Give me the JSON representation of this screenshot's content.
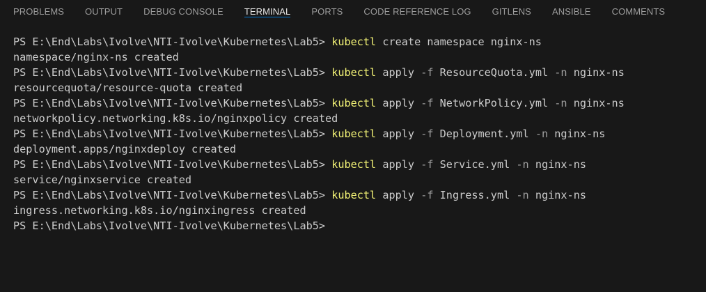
{
  "tabs": [
    {
      "label": "PROBLEMS",
      "active": false
    },
    {
      "label": "OUTPUT",
      "active": false
    },
    {
      "label": "DEBUG CONSOLE",
      "active": false
    },
    {
      "label": "TERMINAL",
      "active": true
    },
    {
      "label": "PORTS",
      "active": false
    },
    {
      "label": "CODE REFERENCE LOG",
      "active": false
    },
    {
      "label": "GITLENS",
      "active": false
    },
    {
      "label": "ANSIBLE",
      "active": false
    },
    {
      "label": "COMMENTS",
      "active": false
    }
  ],
  "terminal": {
    "prompt": "PS E:\\End\\Labs\\Ivolve\\NTI-Ivolve\\Kubernetes\\Lab5> ",
    "entries": [
      {
        "cmd": "kubectl",
        "args": [
          {
            "text": " create namespace nginx-ns",
            "flag": false
          }
        ],
        "output": "namespace/nginx-ns created"
      },
      {
        "cmd": "kubectl",
        "args": [
          {
            "text": " apply ",
            "flag": false
          },
          {
            "text": "-f",
            "flag": true
          },
          {
            "text": " ResourceQuota.yml ",
            "flag": false
          },
          {
            "text": "-n",
            "flag": true
          },
          {
            "text": " nginx-ns",
            "flag": false
          }
        ],
        "output": "resourcequota/resource-quota created"
      },
      {
        "cmd": "kubectl",
        "args": [
          {
            "text": " apply ",
            "flag": false
          },
          {
            "text": "-f",
            "flag": true
          },
          {
            "text": " NetworkPolicy.yml ",
            "flag": false
          },
          {
            "text": "-n",
            "flag": true
          },
          {
            "text": " nginx-ns",
            "flag": false
          }
        ],
        "output": "networkpolicy.networking.k8s.io/nginxpolicy created"
      },
      {
        "cmd": "kubectl",
        "args": [
          {
            "text": " apply ",
            "flag": false
          },
          {
            "text": "-f",
            "flag": true
          },
          {
            "text": " Deployment.yml ",
            "flag": false
          },
          {
            "text": "-n",
            "flag": true
          },
          {
            "text": " nginx-ns",
            "flag": false
          }
        ],
        "output": "deployment.apps/nginxdeploy created"
      },
      {
        "cmd": "kubectl",
        "args": [
          {
            "text": " apply ",
            "flag": false
          },
          {
            "text": "-f",
            "flag": true
          },
          {
            "text": " Service.yml ",
            "flag": false
          },
          {
            "text": "-n",
            "flag": true
          },
          {
            "text": " nginx-ns",
            "flag": false
          }
        ],
        "output": "service/nginxservice created"
      },
      {
        "cmd": "kubectl",
        "args": [
          {
            "text": " apply ",
            "flag": false
          },
          {
            "text": "-f",
            "flag": true
          },
          {
            "text": " Ingress.yml ",
            "flag": false
          },
          {
            "text": "-n",
            "flag": true
          },
          {
            "text": " nginx-ns",
            "flag": false
          }
        ],
        "output": "ingress.networking.k8s.io/nginxingress created"
      }
    ],
    "final_prompt": "PS E:\\End\\Labs\\Ivolve\\NTI-Ivolve\\Kubernetes\\Lab5>"
  },
  "colors": {
    "background": "#181818",
    "text": "#cccccc",
    "command": "#f1f175",
    "flag": "#a0a0a0",
    "active_tab_underline": "#0078d4"
  }
}
